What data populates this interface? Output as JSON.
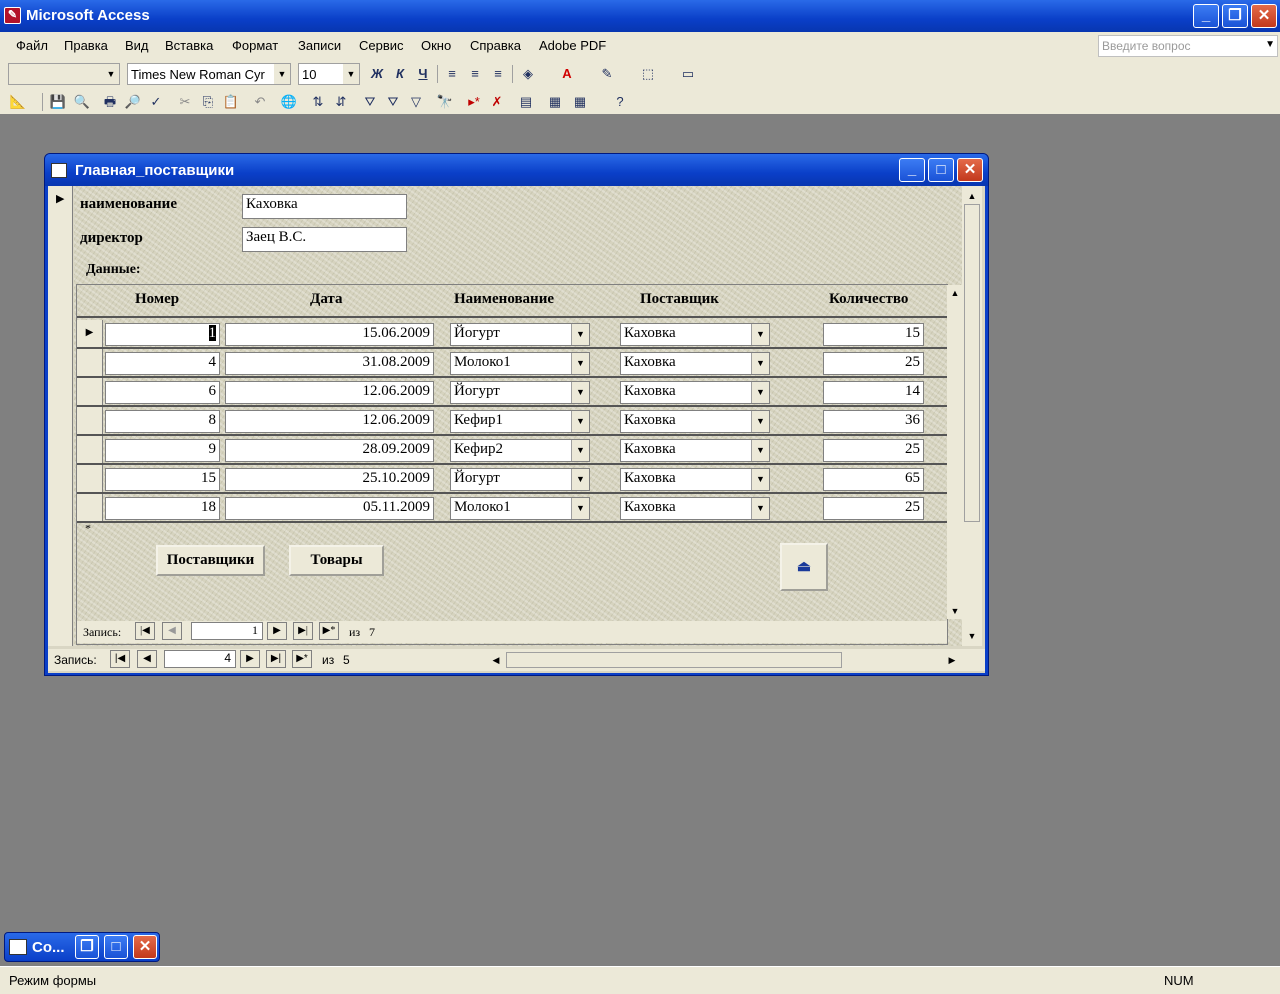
{
  "app": {
    "title": "Microsoft Access"
  },
  "menu": [
    "Файл",
    "Правка",
    "Вид",
    "Вставка",
    "Формат",
    "Записи",
    "Сервис",
    "Окно",
    "Справка",
    "Adobe PDF"
  ],
  "ask": {
    "placeholder": "Введите вопрос"
  },
  "format_toolbar": {
    "font": "Times New Roman Cyr",
    "size": "10",
    "bold": "Ж",
    "italic": "К",
    "underline": "Ч"
  },
  "form": {
    "title": "Главная_поставщики",
    "fields": {
      "name_label": "наименование",
      "name_value": "Каховка",
      "director_label": "директор",
      "director_value": "Заец В.С.",
      "data_label": "Данные:"
    },
    "subform": {
      "columns": [
        "Номер",
        "Дата",
        "Наименование",
        "Поставщик",
        "Количество"
      ],
      "rows": [
        {
          "n": "1",
          "date": "15.06.2009",
          "item": "Йогурт",
          "supplier": "Каховка",
          "qty": "15"
        },
        {
          "n": "4",
          "date": "31.08.2009",
          "item": "Молоко1",
          "supplier": "Каховка",
          "qty": "25"
        },
        {
          "n": "6",
          "date": "12.06.2009",
          "item": "Йогурт",
          "supplier": "Каховка",
          "qty": "14"
        },
        {
          "n": "8",
          "date": "12.06.2009",
          "item": "Кефир1",
          "supplier": "Каховка",
          "qty": "36"
        },
        {
          "n": "9",
          "date": "28.09.2009",
          "item": "Кефир2",
          "supplier": "Каховка",
          "qty": "25"
        },
        {
          "n": "15",
          "date": "25.10.2009",
          "item": "Йогурт",
          "supplier": "Каховка",
          "qty": "65"
        },
        {
          "n": "18",
          "date": "05.11.2009",
          "item": "Молоко1",
          "supplier": "Каховка",
          "qty": "25"
        }
      ],
      "nav": {
        "label": "Запись:",
        "current": "1",
        "of_label": "из",
        "total": "7"
      }
    },
    "buttons": {
      "suppliers": "Поставщики",
      "goods": "Товары"
    },
    "nav": {
      "label": "Запись:",
      "current": "4",
      "of_label": "из",
      "total": "5"
    }
  },
  "minimized": {
    "title": "Co..."
  },
  "status": {
    "mode": "Режим формы",
    "num": "NUM"
  }
}
